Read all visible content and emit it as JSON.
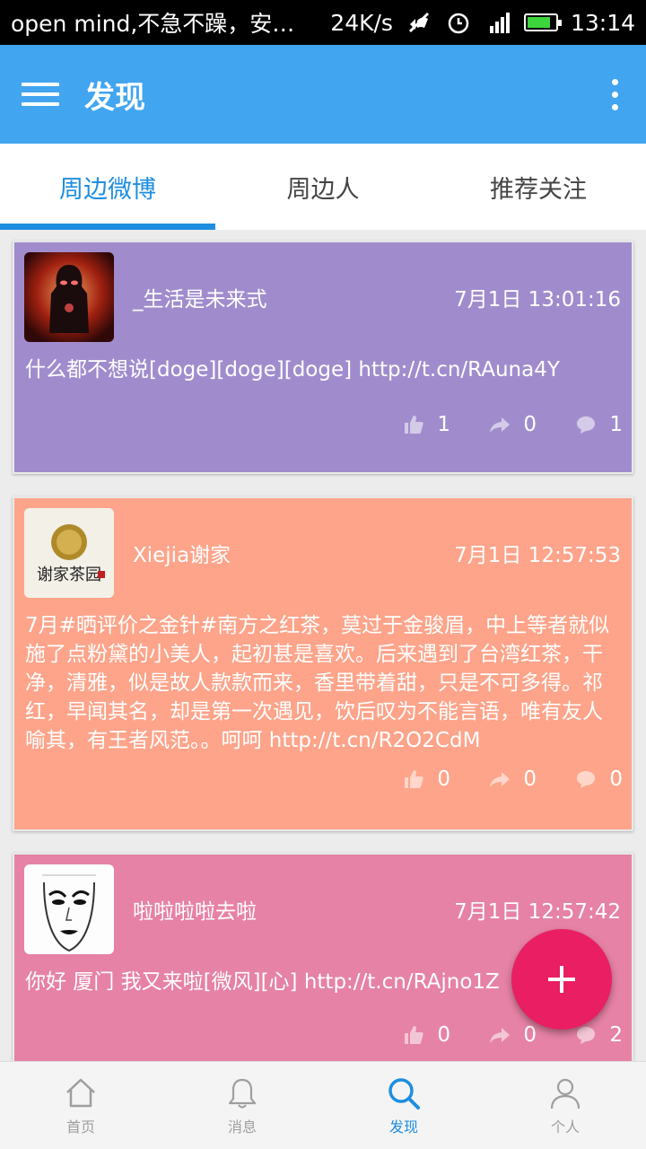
{
  "status_bar": {
    "notification": "open mind,不急不躁，安…",
    "speed": "24K/s",
    "time": "13:14",
    "battery_level": 0.85
  },
  "app_bar": {
    "title": "发现"
  },
  "tabs": [
    {
      "label": "周边微博",
      "active": true
    },
    {
      "label": "周边人",
      "active": false
    },
    {
      "label": "推荐关注",
      "active": false
    }
  ],
  "posts": [
    {
      "user": "_生活是未来式",
      "time": "7月1日 13:01:16",
      "text": "什么都不想说[doge][doge][doge] http://t.cn/RAuna4Y",
      "likes": "1",
      "reposts": "0",
      "comments": "1",
      "bg": "#a08ccd"
    },
    {
      "user": "Xiejia谢家",
      "time": "7月1日 12:57:53",
      "text": "7月#晒评价之金针#南方之红茶，莫过于金骏眉，中上等者就似施了点粉黛的小美人，起初甚是喜欢。后来遇到了台湾红茶，干净，清雅，似是故人款款而来，香里带着甜，只是不可多得。祁红，早闻其名，却是第一次遇见，饮后叹为不能言语，唯有友人喻其，有王者风范。。呵呵 http://t.cn/R2O2CdM",
      "likes": "0",
      "reposts": "0",
      "comments": "0",
      "bg": "#fda48a"
    },
    {
      "user": "啦啦啦啦去啦",
      "time": "7月1日 12:57:42",
      "text": "你好 厦门 我又来啦[微风][心] http://t.cn/RAjno1Z",
      "likes": "0",
      "reposts": "0",
      "comments": "2",
      "bg": "#e682a5"
    }
  ],
  "bottom_nav": [
    {
      "label": "首页",
      "icon": "home-icon"
    },
    {
      "label": "消息",
      "icon": "bell-icon"
    },
    {
      "label": "发现",
      "icon": "search-icon",
      "active": true
    },
    {
      "label": "个人",
      "icon": "person-icon"
    }
  ],
  "colors": {
    "primary": "#41a5f0",
    "accent": "#e91e63",
    "tab_active": "#1e8ee0"
  }
}
